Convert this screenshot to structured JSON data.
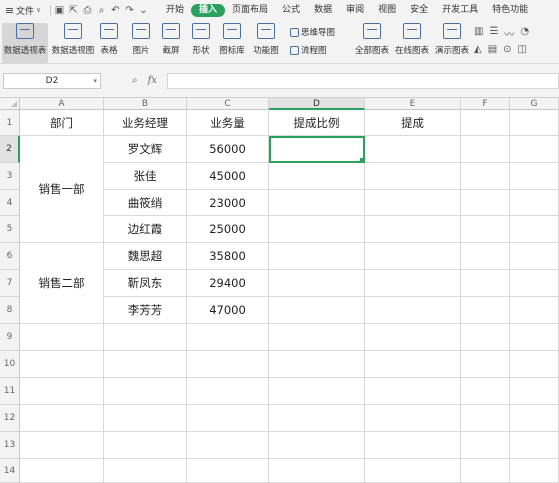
{
  "menubar": {
    "file_label": "文件",
    "tabs": [
      "开始",
      "插入",
      "页面布局",
      "公式",
      "数据",
      "审阅",
      "视图",
      "安全",
      "开发工具",
      "特色功能"
    ],
    "active_tab": "插入"
  },
  "ribbon": {
    "buttons": [
      "数据透视表",
      "数据透视图",
      "表格",
      "图片",
      "截屏",
      "形状",
      "图标库",
      "功能图",
      "全部图表",
      "在线图表",
      "演示图表"
    ],
    "small": [
      "思维导图",
      "流程图"
    ]
  },
  "formula_bar": {
    "name_box": "D2",
    "fx_label": "fx",
    "formula": ""
  },
  "sheet": {
    "columns": [
      "A",
      "B",
      "C",
      "D",
      "E",
      "F",
      "G"
    ],
    "rows": [
      "1",
      "2",
      "3",
      "4",
      "5",
      "6",
      "7",
      "8",
      "9",
      "10",
      "11",
      "12",
      "13",
      "14"
    ],
    "selected_cell": "D2",
    "headers": {
      "A1": "部门",
      "B1": "业务经理",
      "C1": "业务量",
      "D1": "提成比例",
      "E1": "提成"
    },
    "departments": [
      {
        "name": "销售一部",
        "rows": "2-5"
      },
      {
        "name": "销售二部",
        "rows": "6-8"
      }
    ],
    "records": [
      {
        "manager": "罗文辉",
        "volume": "56000"
      },
      {
        "manager": "张佳",
        "volume": "45000"
      },
      {
        "manager": "曲筱绡",
        "volume": "23000"
      },
      {
        "manager": "边红霞",
        "volume": "25000"
      },
      {
        "manager": "魏思超",
        "volume": "35800"
      },
      {
        "manager": "靳凤东",
        "volume": "29400"
      },
      {
        "manager": "李芳芳",
        "volume": "47000"
      }
    ]
  }
}
